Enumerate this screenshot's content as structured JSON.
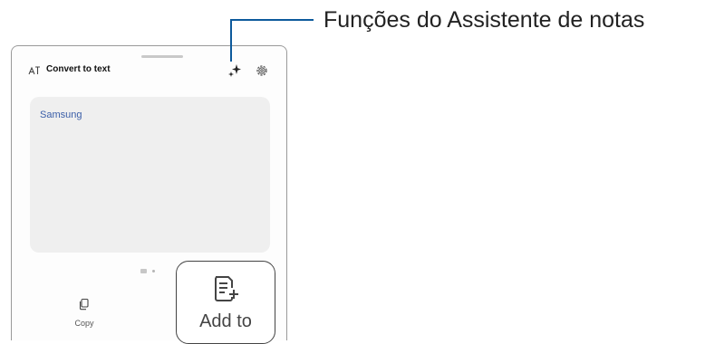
{
  "header": {
    "title": "Convert to text",
    "left_icon": "text-convert-icon",
    "assistant_icon": "sparkle-icon",
    "settings_icon": "gear-icon"
  },
  "content": {
    "recognized_text": "Samsung"
  },
  "pager": {
    "pages": 2,
    "current": 1
  },
  "actions": {
    "copy_label": "Copy",
    "copy_icon": "copy-icon",
    "add_to_label": "Add to",
    "add_to_icon": "add-to-note-icon"
  },
  "callout": {
    "text": "Funções do Assistente de notas",
    "color": "#0d5a9c"
  },
  "colors": {
    "text_accent": "#3a5ea8",
    "card_bg": "#efefef"
  }
}
